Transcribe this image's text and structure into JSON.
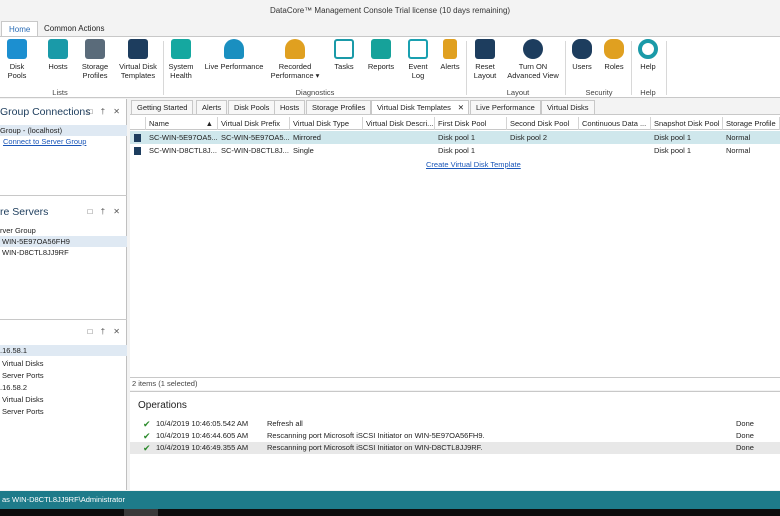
{
  "window": {
    "title": "DataCore™ Management Console   Trial license (10 days remaining)"
  },
  "ribbon_tabs": [
    "Home",
    "Common Actions"
  ],
  "ribbon": {
    "buttons": [
      {
        "label": "Disk Pools",
        "icon": "disk-pools-icon",
        "color": "#1c8fd0"
      },
      {
        "label": "Hosts",
        "icon": "hosts-icon",
        "color": "#1a9aa8"
      },
      {
        "label": "Storage\nProfiles",
        "icon": "storage-profiles-icon",
        "color": "#5a6b7a"
      },
      {
        "label": "Virtual Disk\nTemplates",
        "icon": "virtual-disk-templates-icon",
        "color": "#1d3d5e"
      },
      {
        "label": "System\nHealth",
        "icon": "system-health-icon",
        "color": "#15a8a0"
      },
      {
        "label": "Live Performance",
        "icon": "live-performance-icon",
        "color": "#1a8fc0"
      },
      {
        "label": "Recorded\nPerformance ▾",
        "icon": "recorded-performance-icon",
        "color": "#e0a020"
      },
      {
        "label": "Tasks",
        "icon": "tasks-icon",
        "color": "#1a9aa8"
      },
      {
        "label": "Reports",
        "icon": "reports-icon",
        "color": "#16a29a"
      },
      {
        "label": "Event\nLog",
        "icon": "event-log-icon",
        "color": "#1aa0b0"
      },
      {
        "label": "Alerts",
        "icon": "alerts-icon",
        "color": "#e0a020"
      },
      {
        "label": "Reset\nLayout",
        "icon": "reset-layout-icon",
        "color": "#1d3d5e"
      },
      {
        "label": "Turn ON\nAdvanced View",
        "icon": "advanced-view-icon",
        "color": "#1d3d5e"
      },
      {
        "label": "Users",
        "icon": "users-icon",
        "color": "#1d3d5e"
      },
      {
        "label": "Roles",
        "icon": "roles-icon",
        "color": "#e0a020"
      },
      {
        "label": "Help",
        "icon": "help-icon",
        "color": "#1a9aa8"
      }
    ],
    "groups": [
      "Lists",
      "Diagnostics",
      "Layout",
      "Security",
      "Help"
    ]
  },
  "left_panels": {
    "group_connections": {
      "title": "Group Connections",
      "items": [
        "Group - (localhost)",
        "Connect to Server Group"
      ]
    },
    "servers": {
      "title": "re Servers",
      "items": [
        "rver Group",
        "WIN-5E97OA56FH9",
        "WIN-D8CTL8JJ9RF"
      ]
    },
    "ports": {
      "items": [
        ".16.58.1",
        "Virtual Disks",
        "Server Ports",
        ".16.58.2",
        "Virtual Disks",
        "Server Ports"
      ]
    },
    "pin_glyphs": "□ † ✕"
  },
  "doc_tabs": [
    "Getting Started",
    "Alerts",
    "Disk Pools",
    "Hosts",
    "Storage Profiles",
    "Virtual Disk Templates",
    "Live Performance",
    "Virtual Disks"
  ],
  "doc_tab_close": "✕",
  "grid": {
    "columns": [
      "Name",
      "Virtual Disk Prefix",
      "Virtual Disk Type",
      "Virtual Disk Descri...",
      "First Disk Pool",
      "Second Disk Pool",
      "Continuous Data ...",
      "Snapshot Disk Pool",
      "Storage Profile"
    ],
    "rows": [
      [
        "SC-WIN-5E97OA5...",
        "SC-WIN-5E97OA5...",
        "Mirrored",
        "",
        "Disk pool 1",
        "Disk pool 2",
        "",
        "Disk pool 1",
        "Normal"
      ],
      [
        "SC-WIN-D8CTL8J...",
        "SC-WIN-D8CTL8J...",
        "Single",
        "",
        "Disk pool 1",
        "",
        "",
        "Disk pool 1",
        "Normal"
      ]
    ],
    "create_link": "Create Virtual Disk Template",
    "status": "2 items (1 selected)"
  },
  "operations": {
    "title": "Operations",
    "rows": [
      {
        "time": "10/4/2019 10:46:05.542 AM",
        "desc": "Refresh all",
        "status": "Done"
      },
      {
        "time": "10/4/2019 10:46:44.605 AM",
        "desc": "Rescanning port Microsoft iSCSI Initiator on WIN-5E97OA56FH9.",
        "status": "Done"
      },
      {
        "time": "10/4/2019 10:46:49.355 AM",
        "desc": "Rescanning port Microsoft iSCSI Initiator on WIN-D8CTL8JJ9RF.",
        "status": "Done"
      }
    ]
  },
  "statusbar": {
    "text": "as WIN-D8CTL8JJ9RF\\Administrator"
  }
}
